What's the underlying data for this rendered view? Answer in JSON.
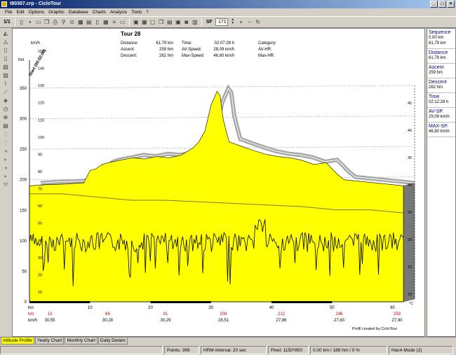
{
  "window": {
    "title": "t80307.crp - CicloTour",
    "buttons": [
      "_",
      "□",
      "×"
    ]
  },
  "menu": [
    "File",
    "Edit",
    "Options",
    "Graphic",
    "Database",
    "Charts",
    "Analysis",
    "Tools",
    "?"
  ],
  "toolbar": {
    "page_label": "1/1",
    "sf_label": "SF",
    "sf_value": "171"
  },
  "chart_info": {
    "title": "Tour 28",
    "rows": [
      {
        "l1": "Distance:",
        "v1": "61,79 km",
        "l2": "Time:",
        "v2": "02:07:28 h",
        "l3": "Category:",
        "v3": ""
      },
      {
        "l1": "Ascent:",
        "v1": "259 hm",
        "l2": "AV-Speed:",
        "v2": "28,09 km/h",
        "l3": "AV-HR:",
        "v3": ""
      },
      {
        "l1": "Descent:",
        "v1": "262 hm",
        "l2": "Max-Speed:",
        "v2": "46,80 km/h",
        "l3": "Max-HR:",
        "v3": ""
      }
    ],
    "start_label": "Start (00:02:00)",
    "footer": "Profil created by CicloTour"
  },
  "chart_data": {
    "type": "area",
    "xlabel": "km",
    "x_ticks": [
      "10",
      "20",
      "30",
      "40",
      "50",
      "60"
    ],
    "xlim": [
      0,
      61.79
    ],
    "altitude_axis": {
      "unit": "hm",
      "ticks": [
        "0",
        "50",
        "100",
        "150",
        "200",
        "250",
        "300",
        "350"
      ],
      "ylim": [
        0,
        350
      ]
    },
    "speed_axis": {
      "unit": "km/h",
      "ticks": [
        "10",
        "20",
        "30",
        "40",
        "50",
        "60",
        "70",
        "80",
        "90",
        "100",
        "110",
        "120",
        "130",
        "140",
        "150"
      ]
    },
    "right_axis": {
      "unit": "°C",
      "ticks": [
        "10",
        "15",
        "20",
        "25",
        "30",
        "35",
        "40",
        "45"
      ]
    },
    "altitude_profile": {
      "x": [
        0,
        3,
        6,
        9,
        9.5,
        10,
        11,
        12,
        13,
        15,
        17,
        19,
        21,
        23,
        25,
        27,
        28,
        29,
        30,
        31,
        31.5,
        32,
        32.5,
        33,
        35,
        37,
        39,
        41,
        43,
        45,
        47,
        49,
        51,
        52,
        54,
        56,
        58,
        60,
        61.79
      ],
      "y": [
        190,
        192,
        193,
        195,
        205,
        215,
        218,
        225,
        228,
        232,
        236,
        234,
        238,
        236,
        240,
        252,
        262,
        280,
        322,
        345,
        338,
        300,
        280,
        262,
        255,
        248,
        242,
        238,
        236,
        232,
        225,
        228,
        208,
        200,
        198,
        196,
        194,
        192,
        190
      ]
    },
    "speed_rows": {
      "label_hm": "hm",
      "label_kmh": "km/h",
      "km": [
        "0",
        "10",
        "20",
        "30",
        "40",
        "50",
        "60"
      ],
      "hm": [
        "13",
        "66",
        "91",
        "208",
        "212",
        "246",
        "259"
      ],
      "kmh": [
        "30,55",
        "30,28",
        "30,29",
        "28,51",
        "27,86",
        "27,83",
        "27,90"
      ]
    },
    "line_level": [
      68,
      68,
      66,
      64,
      64,
      63,
      62,
      61,
      60,
      58,
      58,
      56
    ]
  },
  "right_panel": [
    {
      "head": "Sequence",
      "vals": [
        "0,00 km",
        "61,79 km"
      ]
    },
    {
      "head": "Distance",
      "vals": [
        "61,79 km"
      ]
    },
    {
      "head": "Ascent",
      "vals": [
        "259 hm"
      ]
    },
    {
      "head": "Descent",
      "vals": [
        "262 hm"
      ]
    },
    {
      "head": "Time",
      "vals": [
        "02:12:28 h"
      ]
    },
    {
      "head": "AV-SP.",
      "vals": [
        "29,09 km/h"
      ]
    },
    {
      "head": "MAX-SP.",
      "vals": [
        "46,80 km/h"
      ]
    }
  ],
  "tabs": [
    "Altitude Profile",
    "Yearly Chart",
    "Monthly Chart",
    "Daily Details"
  ],
  "status": {
    "points": "Points: 399",
    "interval": "HRM-Interval: 20 sec",
    "pixel": "Pixel: 1150*850",
    "range": "0,00 km / 188 hm / 0 %",
    "mode": "Hac4-Mode (2)"
  },
  "colors": {
    "fill": "#ffff00",
    "shadow": "#a8a8a8",
    "accent_text": "#000080",
    "hm_red": "#cc0000"
  }
}
